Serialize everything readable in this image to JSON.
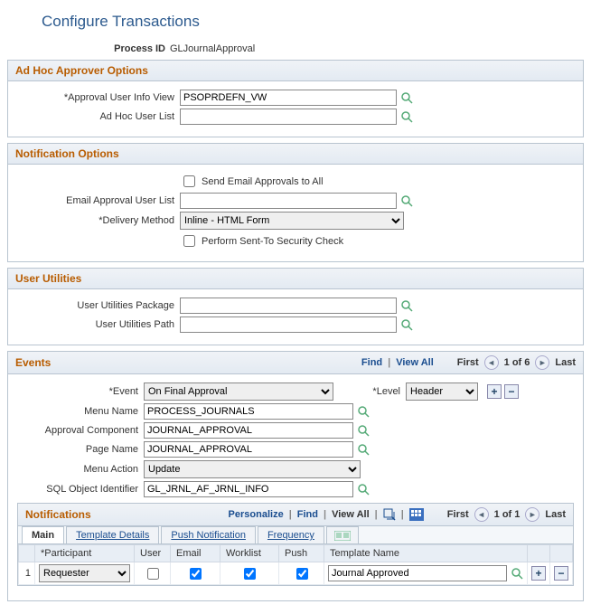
{
  "pageTitle": "Configure Transactions",
  "processIdLabel": "Process ID",
  "processId": "GLJournalApproval",
  "adHoc": {
    "title": "Ad Hoc Approver Options",
    "approvalUserInfoViewLabel": "*Approval User Info View",
    "approvalUserInfoView": "PSOPRDEFN_VW",
    "adHocUserListLabel": "Ad Hoc User List",
    "adHocUserList": ""
  },
  "notificationOptions": {
    "title": "Notification Options",
    "sendEmailAllLabel": "Send Email Approvals to All",
    "sendEmailAll": false,
    "emailApprovalUserListLabel": "Email Approval User List",
    "emailApprovalUserList": "",
    "deliveryMethodLabel": "*Delivery Method",
    "deliveryMethod": "Inline - HTML Form",
    "performSentToLabel": "Perform Sent-To Security Check",
    "performSentTo": false
  },
  "userUtilities": {
    "title": "User Utilities",
    "packageLabel": "User Utilities Package",
    "packageValue": "",
    "pathLabel": "User Utilities Path",
    "pathValue": ""
  },
  "events": {
    "title": "Events",
    "findLabel": "Find",
    "viewAllLabel": "View All",
    "firstLabel": "First",
    "lastLabel": "Last",
    "counter": "1 of 6",
    "eventLabel": "*Event",
    "eventValue": "On Final Approval",
    "levelLabel": "*Level",
    "levelValue": "Header",
    "menuNameLabel": "Menu Name",
    "menuName": "PROCESS_JOURNALS",
    "approvalComponentLabel": "Approval Component",
    "approvalComponent": "JOURNAL_APPROVAL",
    "pageNameLabel": "Page Name",
    "pageName": "JOURNAL_APPROVAL",
    "menuActionLabel": "Menu Action",
    "menuAction": "Update",
    "sqlObjIdLabel": "SQL Object Identifier",
    "sqlObjId": "GL_JRNL_AF_JRNL_INFO"
  },
  "notifications": {
    "title": "Notifications",
    "personalizeLabel": "Personalize",
    "findLabel": "Find",
    "viewAllLabel": "View All",
    "firstLabel": "First",
    "lastLabel": "Last",
    "counter": "1 of 1",
    "tabs": {
      "main": "Main",
      "templateDetails": "Template Details",
      "pushNotification": "Push Notification",
      "frequency": "Frequency"
    },
    "cols": {
      "rowNum": "",
      "participant": "*Participant",
      "user": "User",
      "email": "Email",
      "worklist": "Worklist",
      "push": "Push",
      "templateName": "Template Name"
    },
    "row": {
      "num": "1",
      "participant": "Requester",
      "user": false,
      "email": true,
      "worklist": true,
      "push": true,
      "templateName": "Journal Approved"
    }
  }
}
